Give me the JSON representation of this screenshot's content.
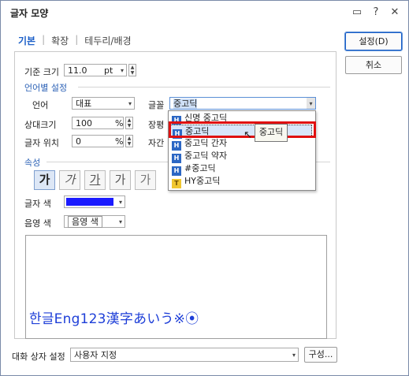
{
  "window": {
    "title": "글자 모양"
  },
  "titlebar_icons": [
    "chat-icon",
    "help-icon",
    "close-icon"
  ],
  "titlebar_glyphs": {
    "chat": "▭",
    "help": "?",
    "close": "✕"
  },
  "tabs": [
    {
      "label": "기본"
    },
    {
      "label": "확장"
    },
    {
      "label": "테두리/배경"
    }
  ],
  "base_size": {
    "label": "기준 크기",
    "value": "11.0",
    "unit": "pt"
  },
  "lang_section": {
    "title": "언어별 설정"
  },
  "language": {
    "label": "언어",
    "value": "대표"
  },
  "font": {
    "label": "글꼴",
    "value": "중고딕"
  },
  "relative_size": {
    "label": "상대크기",
    "value": "100",
    "unit": "%"
  },
  "ratio": {
    "label": "장평"
  },
  "position": {
    "label": "글자 위치",
    "value": "0",
    "unit": "%"
  },
  "spacing": {
    "label": "자간"
  },
  "font_list": {
    "items": [
      {
        "label": "신명 중고딕",
        "icon": "H"
      },
      {
        "label": "중고딕",
        "icon": "H",
        "highlighted": true
      },
      {
        "label": "중고딕 간자",
        "icon": "H"
      },
      {
        "label": "중고딕 약자",
        "icon": "H"
      },
      {
        "label": "#중고딕",
        "icon": "H"
      },
      {
        "label": "HY중고딕",
        "icon": "T"
      }
    ],
    "tooltip": "중고딕"
  },
  "attributes": {
    "title": "속성",
    "buttons": [
      "가",
      "가",
      "가",
      "가",
      "가"
    ]
  },
  "text_color": {
    "label": "글자 색",
    "color": "#1b1bff"
  },
  "shade_color": {
    "label": "음영 색",
    "value": "음영 색"
  },
  "preview": {
    "text": "한글Eng123漢字あいう※⦿"
  },
  "bottom": {
    "label": "대화 상자 설정",
    "value": "사용자 지정",
    "config_button": "구성..."
  },
  "buttons": {
    "ok": "설정(D)",
    "cancel": "취소"
  },
  "colors": {
    "accent": "#1b5fc8",
    "highlight_box": "#e01010",
    "preview_text": "#1e3fd8"
  }
}
